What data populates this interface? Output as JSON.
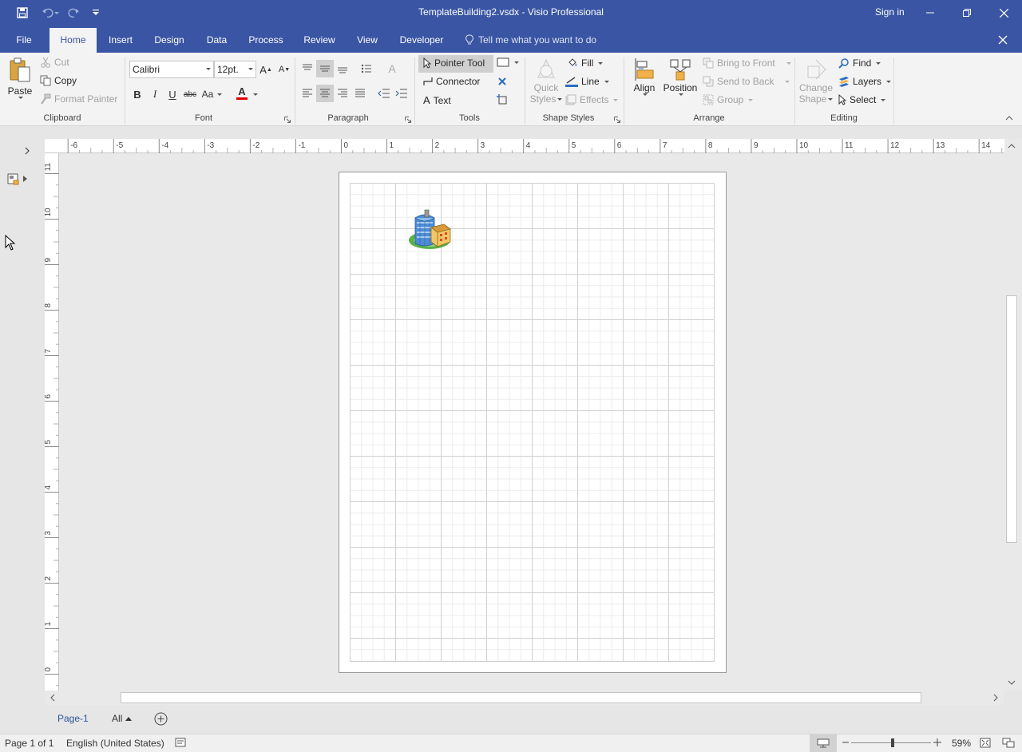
{
  "window": {
    "title": "TemplateBuilding2.vsdx - Visio Professional",
    "sign_in": "Sign in"
  },
  "tabs": {
    "file": "File",
    "home": "Home",
    "insert": "Insert",
    "design": "Design",
    "data": "Data",
    "process": "Process",
    "review": "Review",
    "view": "View",
    "developer": "Developer",
    "tell_me": "Tell me what you want to do"
  },
  "clipboard": {
    "paste": "Paste",
    "cut": "Cut",
    "copy": "Copy",
    "format_painter": "Format Painter",
    "label": "Clipboard"
  },
  "font": {
    "family": "Calibri",
    "size": "12pt.",
    "bold": "B",
    "italic": "I",
    "underline": "U",
    "strikethrough": "abc",
    "change_case": "Aa",
    "color_glyph": "A",
    "label": "Font"
  },
  "paragraph": {
    "label": "Paragraph"
  },
  "tools": {
    "pointer": "Pointer Tool",
    "connector": "Connector",
    "text": "Text",
    "label": "Tools"
  },
  "shape_styles": {
    "fill": "Fill",
    "line": "Line",
    "effects": "Effects",
    "quick_styles_1": "Quick",
    "quick_styles_2": "Styles",
    "label": "Shape Styles"
  },
  "arrange": {
    "align": "Align",
    "position": "Position",
    "bring_to_front": "Bring to Front",
    "send_to_back": "Send to Back",
    "group": "Group",
    "label": "Arrange"
  },
  "editing": {
    "change_shape_1": "Change",
    "change_shape_2": "Shape",
    "find": "Find",
    "layers": "Layers",
    "select": "Select",
    "label": "Editing"
  },
  "ruler": {
    "top": [
      "-6",
      "-5",
      "-4",
      "-3",
      "-2",
      "-1",
      "0",
      "1",
      "2",
      "3",
      "4",
      "5",
      "6",
      "7",
      "8",
      "9",
      "10",
      "11",
      "12",
      "13",
      "14"
    ],
    "left": [
      "11",
      "10",
      "9",
      "8",
      "7",
      "6",
      "5",
      "4",
      "3",
      "2",
      "1",
      "0"
    ]
  },
  "page_tabs": {
    "page1": "Page-1",
    "all": "All"
  },
  "status": {
    "page": "Page 1 of 1",
    "language": "English (United States)",
    "zoom": "59%"
  },
  "colors": {
    "accent": "#3955a3",
    "font_color_bar": "#e00000"
  }
}
